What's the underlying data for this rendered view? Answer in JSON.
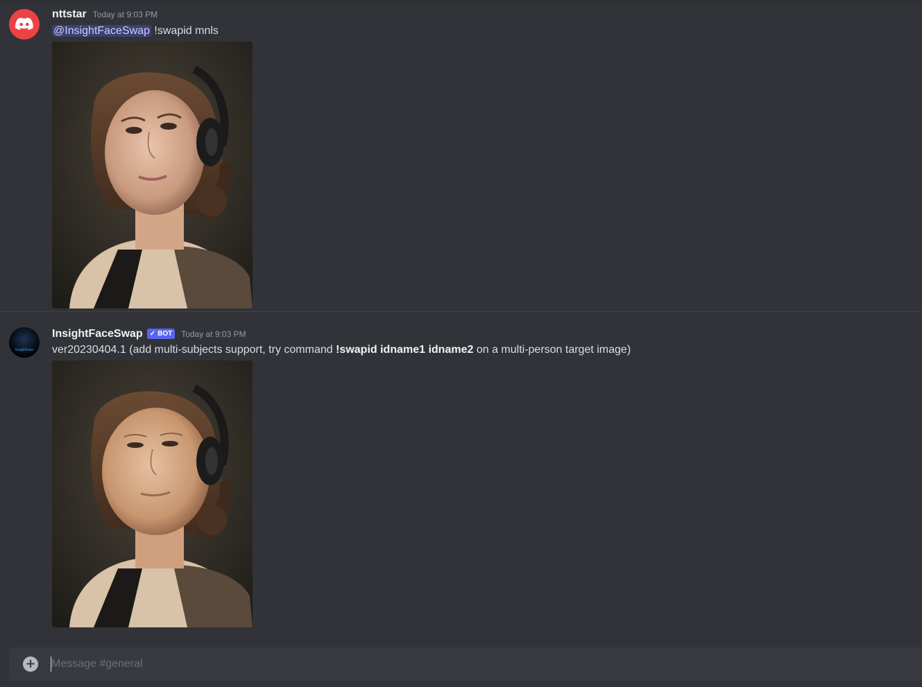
{
  "messages": [
    {
      "username": "nttstar",
      "timestamp": "Today at 9:03 PM",
      "mention": "@InsightFaceSwap",
      "text": " !swapid mnls",
      "attachment": "portrait-original"
    },
    {
      "username": "InsightFaceSwap",
      "bot_tag": "BOT",
      "bot_check": "✓",
      "timestamp": "Today at 9:03 PM",
      "text_before": "ver20230404.1 (add multi-subjects support, try command ",
      "command": "!swapid idname1 idname2",
      "text_after": " on a multi-person target image)",
      "avatar_text": "InsightFace",
      "attachment": "portrait-swapped"
    }
  ],
  "composer": {
    "placeholder": "Message #general"
  },
  "colors": {
    "background": "#313338",
    "composer": "#383a40",
    "mention_bg": "#5865f2",
    "bot_tag": "#5865f2",
    "discord_avatar": "#ed4245"
  },
  "icons": {
    "discord_avatar": "discord-logo-icon",
    "add": "plus-circle-icon"
  }
}
